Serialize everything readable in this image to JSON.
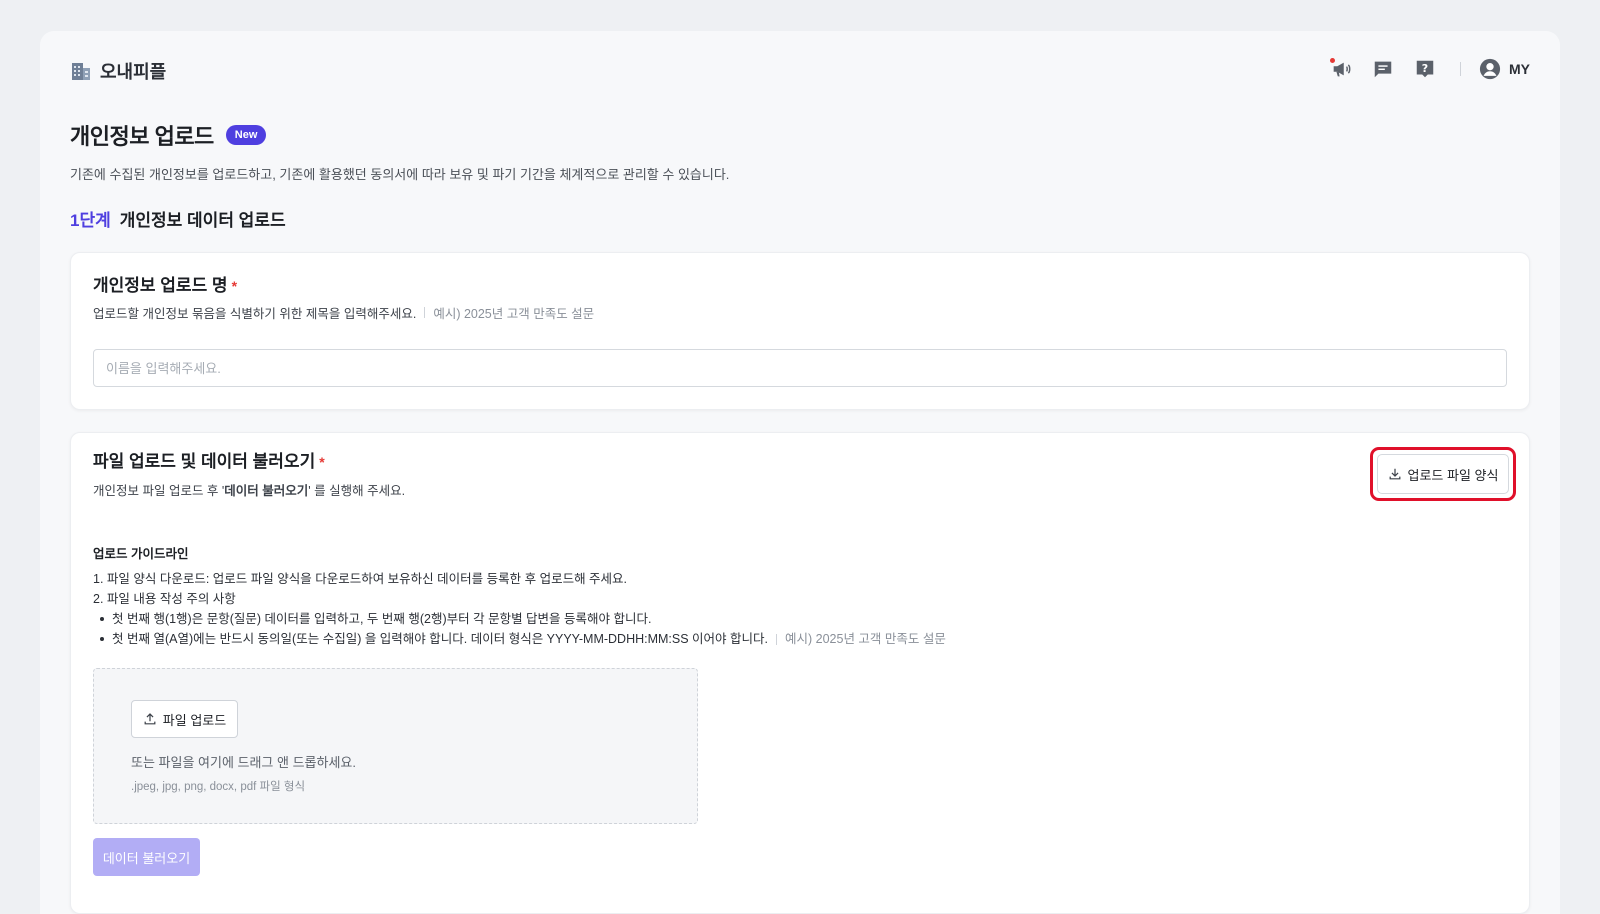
{
  "app": {
    "name": "오내피플",
    "user_label": "MY"
  },
  "header_icons": [
    "megaphone-icon",
    "chat-icon",
    "help-icon",
    "user-avatar-icon"
  ],
  "page": {
    "title": "개인정보 업로드",
    "badge": "New",
    "description": "기존에 수집된 개인정보를 업로드하고, 기존에 활용했던 동의서에 따라 보유 및 파기 기간을 체계적으로 관리할 수 있습니다."
  },
  "step": {
    "number": "1단계",
    "title": "개인정보 데이터 업로드"
  },
  "name_section": {
    "title": "개인정보 업로드 명",
    "required_mark": "*",
    "help": "업로드할 개인정보 묶음을 식별하기 위한 제목을 입력해주세요.",
    "example": "예시) 2025년 고객 만족도 설문",
    "input_placeholder": "이름을 입력해주세요.",
    "input_value": ""
  },
  "file_section": {
    "title": "파일 업로드 및 데이터 불러오기",
    "required_mark": "*",
    "help_prefix": "개인정보 파일 업로드 후 '",
    "help_bold": "데이터 불러오기",
    "help_suffix": "' 를 실행해 주세요.",
    "template_button": "업로드 파일 양식",
    "guide_title": "업로드 가이드라인",
    "guide_items": [
      "1. 파일 양식 다운로드: 업로드 파일 양식을 다운로드하여 보유하신 데이터를 등록한 후 업로드해 주세요.",
      "2. 파일 내용 작성 주의 사항",
      "첫 번째 행(1행)은 문항(질문) 데이터를 입력하고, 두 번째 행(2행)부터 각 문항별 답변을 등록해야 합니다.",
      "첫 번째 열(A열)에는 반드시 동의일(또는 수집일) 을 입력해야 합니다. 데이터 형식은 YYYY-MM-DDHH:MM:SS 이어야 합니다."
    ],
    "guide_example": "예시) 2025년 고객 만족도 설문",
    "upload_button": "파일 업로드",
    "drop_hint": "또는 파일을 여기에 드래그 앤 드롭하세요.",
    "formats": ".jpeg, jpg, png, docx, pdf 파일 형식",
    "load_button": "데이터 불러오기"
  },
  "colors": {
    "accent": "#4f3fe0",
    "required": "#e53935",
    "highlight": "#e0102a",
    "disabled_button": "#b2adf5"
  }
}
